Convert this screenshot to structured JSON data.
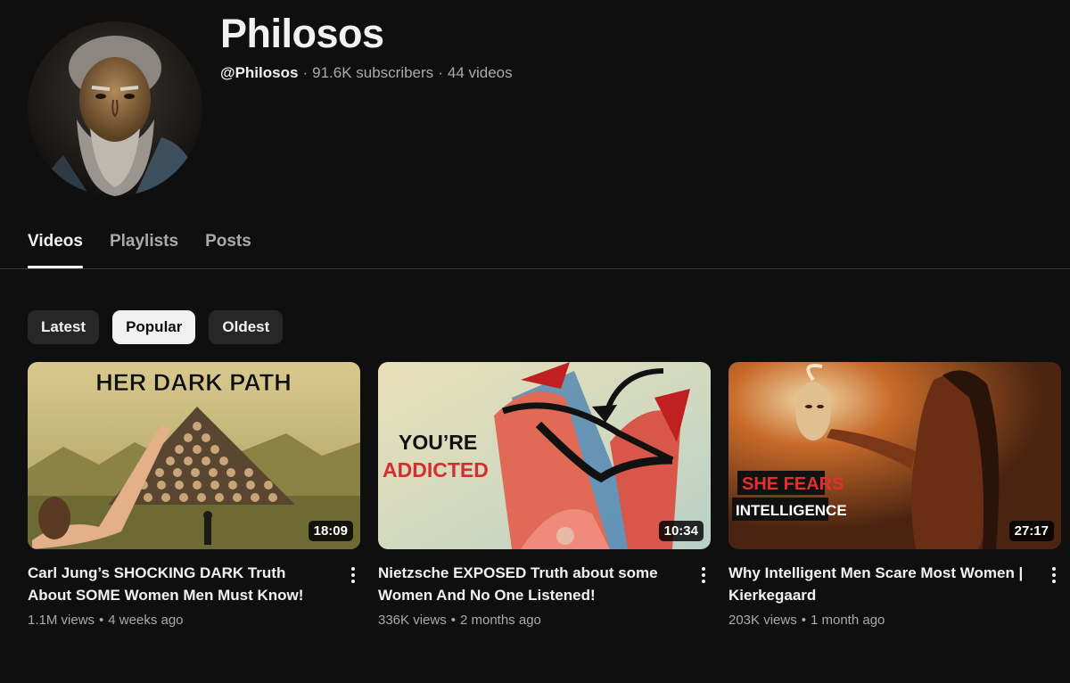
{
  "channel": {
    "name": "Philosos",
    "handle": "@Philosos",
    "subscribers": "91.6K subscribers",
    "videos_count": "44 videos",
    "separator": "·"
  },
  "tabs": [
    {
      "label": "Videos",
      "active": true
    },
    {
      "label": "Playlists",
      "active": false
    },
    {
      "label": "Posts",
      "active": false
    }
  ],
  "filters": [
    {
      "label": "Latest",
      "active": false
    },
    {
      "label": "Popular",
      "active": true
    },
    {
      "label": "Oldest",
      "active": false
    }
  ],
  "videos": [
    {
      "title": "Carl Jung’s SHOCKING DARK Truth About SOME Women Men Must Know!",
      "views": "1.1M views",
      "age": "4 weeks ago",
      "duration": "18:09",
      "thumb_text": [
        "HER DARK PATH"
      ]
    },
    {
      "title": "Nietzsche EXPOSED Truth about some Women And No One Listened!",
      "views": "336K views",
      "age": "2 months ago",
      "duration": "10:34",
      "thumb_text": [
        "YOU’RE",
        "ADDICTED"
      ]
    },
    {
      "title": "Why Intelligent Men Scare Most Women | Kierkegaard",
      "views": "203K views",
      "age": "1 month ago",
      "duration": "27:17",
      "thumb_text": [
        "SHE FEARS",
        "INTELLIGENCE"
      ]
    }
  ],
  "meta_dot": "•",
  "icons": {
    "avatar": "bearded-philosopher-portrait",
    "video_menu": "more-vert-icon"
  }
}
